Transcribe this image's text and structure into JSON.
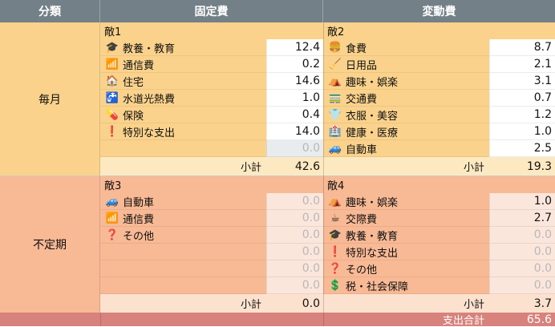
{
  "headers": {
    "category": "分類",
    "fixed": "固定費",
    "variable": "変動費"
  },
  "rows": {
    "monthly": {
      "label": "毎月",
      "fixed": {
        "title": "敵1",
        "items": [
          {
            "icon": "graduation-cap-icon",
            "glyph": "🎓",
            "label": "教養・教育",
            "value": "12.4"
          },
          {
            "icon": "wifi-icon",
            "glyph": "📶",
            "label": "通信費",
            "value": "0.2"
          },
          {
            "icon": "house-icon",
            "glyph": "🏠",
            "label": "住宅",
            "value": "14.6"
          },
          {
            "icon": "faucet-icon",
            "glyph": "🚰",
            "label": "水道光熱費",
            "value": "1.0"
          },
          {
            "icon": "pill-icon",
            "glyph": "💊",
            "label": "保険",
            "value": "0.4"
          },
          {
            "icon": "exclamation-icon",
            "glyph": "❗",
            "label": "特別な支出",
            "value": "14.0"
          },
          {
            "icon": "",
            "glyph": "",
            "label": "",
            "value": "0.0"
          }
        ],
        "subtotal_label": "小計",
        "subtotal": "42.6"
      },
      "variable": {
        "title": "敵2",
        "items": [
          {
            "icon": "hamburger-icon",
            "glyph": "🍔",
            "label": "食費",
            "value": "8.7"
          },
          {
            "icon": "broom-icon",
            "glyph": "🧹",
            "label": "日用品",
            "value": "2.1"
          },
          {
            "icon": "tent-icon",
            "glyph": "⛺",
            "label": "趣味・娯楽",
            "value": "3.1"
          },
          {
            "icon": "train-icon",
            "glyph": "🚃",
            "label": "交通費",
            "value": "0.7"
          },
          {
            "icon": "shirt-icon",
            "glyph": "👕",
            "label": "衣服・美容",
            "value": "1.2"
          },
          {
            "icon": "hospital-icon",
            "glyph": "🏥",
            "label": "健康・医療",
            "value": "1.0"
          },
          {
            "icon": "car-icon",
            "glyph": "🚙",
            "label": "自動車",
            "value": "2.5"
          }
        ],
        "subtotal_label": "小計",
        "subtotal": "19.3"
      }
    },
    "irregular": {
      "label": "不定期",
      "fixed": {
        "title": "敵3",
        "items": [
          {
            "icon": "car-icon",
            "glyph": "🚙",
            "label": "自動車",
            "value": "0.0"
          },
          {
            "icon": "wifi-icon",
            "glyph": "📶",
            "label": "通信費",
            "value": "0.0"
          },
          {
            "icon": "question-icon",
            "glyph": "❓",
            "label": "その他",
            "value": "0.0"
          },
          {
            "icon": "",
            "glyph": "",
            "label": "",
            "value": "0.0"
          },
          {
            "icon": "",
            "glyph": "",
            "label": "",
            "value": "0.0"
          },
          {
            "icon": "",
            "glyph": "",
            "label": "",
            "value": "0.0"
          }
        ],
        "subtotal_label": "小計",
        "subtotal": "0.0"
      },
      "variable": {
        "title": "敵4",
        "items": [
          {
            "icon": "tent-icon",
            "glyph": "⛺",
            "label": "趣味・娯楽",
            "value": "1.0"
          },
          {
            "icon": "coffee-icon",
            "glyph": "☕",
            "label": "交際費",
            "value": "2.7"
          },
          {
            "icon": "graduation-cap-icon",
            "glyph": "🎓",
            "label": "教養・教育",
            "value": "0.0"
          },
          {
            "icon": "exclamation-icon",
            "glyph": "❗",
            "label": "特別な支出",
            "value": "0.0"
          },
          {
            "icon": "question-icon",
            "glyph": "❓",
            "label": "その他",
            "value": "0.0"
          },
          {
            "icon": "dollar-icon",
            "glyph": "💲",
            "label": "税・社会保障",
            "value": "0.0"
          }
        ],
        "subtotal_label": "小計",
        "subtotal": "3.7"
      }
    }
  },
  "total": {
    "label": "支出合計",
    "value": "65.6"
  },
  "colors": {
    "header": "#738087",
    "monthly_dark": "#fad28c",
    "monthly_light": "#fde9c1",
    "monthly_value": "#e8ecef",
    "irregular_dark": "#f8b995",
    "irregular_light": "#fde1cf",
    "irregular_value": "#fbe6dc",
    "total": "#d7827c"
  }
}
